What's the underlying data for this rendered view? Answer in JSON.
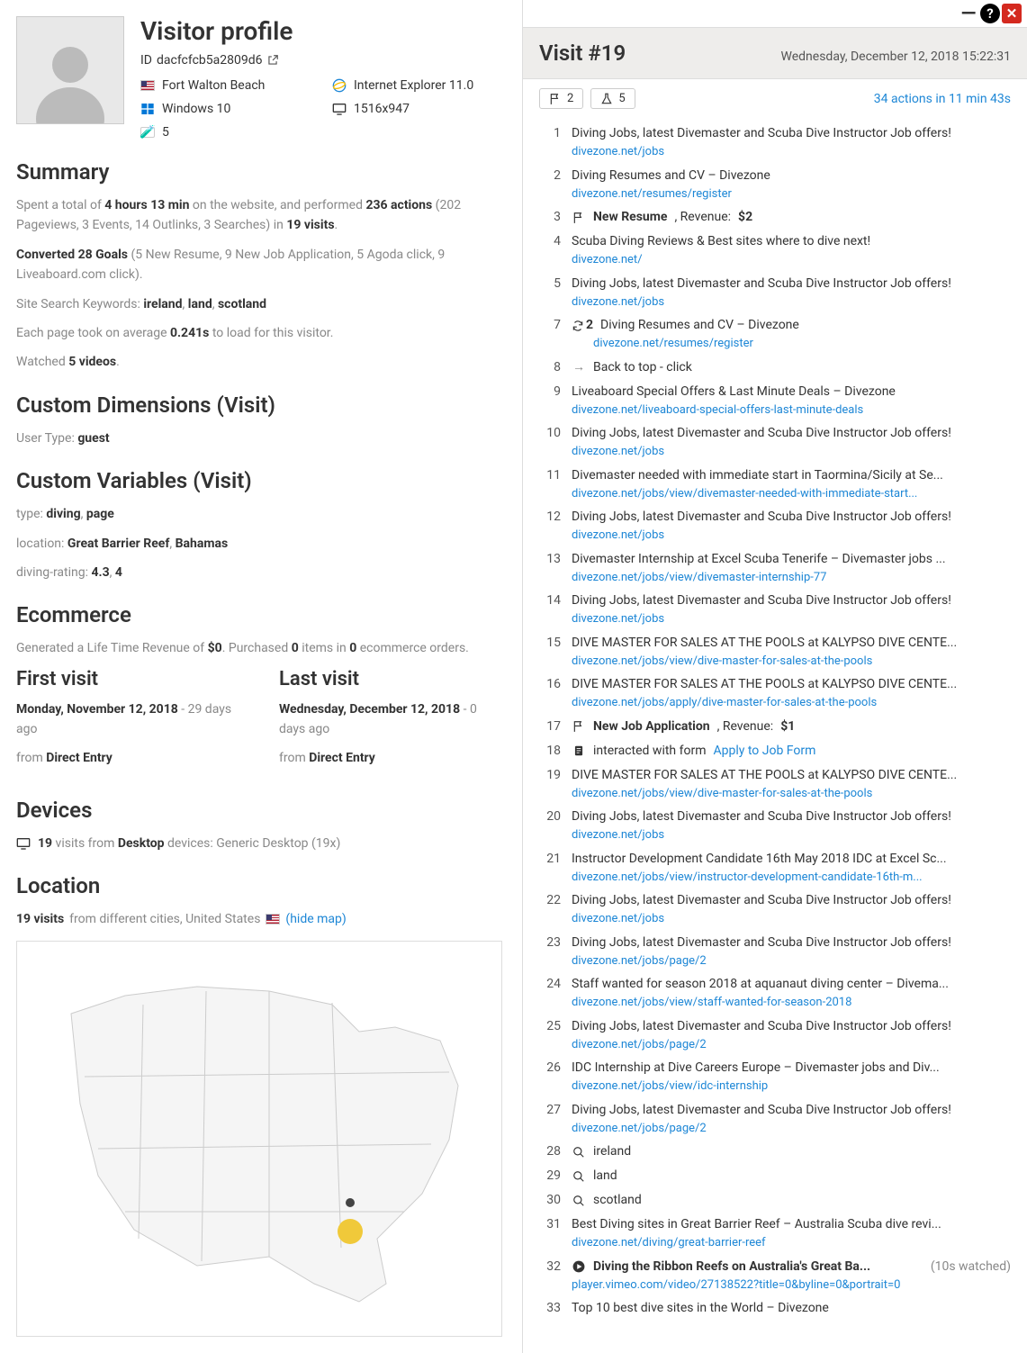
{
  "profile": {
    "title": "Visitor profile",
    "id_label": "ID",
    "id": "dacfcfcb5a2809d6",
    "location": "Fort Walton Beach",
    "browser": "Internet Explorer 11.0",
    "os": "Windows 10",
    "resolution": "1516x947",
    "goals_count": "5"
  },
  "summary": {
    "heading": "Summary",
    "l1a": "Spent a total of ",
    "l1b": "4 hours 13 min",
    "l1c": " on the website, and performed ",
    "l1d": "236 actions",
    "l1e": " (202 Pageviews, 3 Events, 14 Outlinks, 3 Searches) in ",
    "l1f": "19 visits",
    "l1g": ".",
    "l2a": "Converted 28 Goals ",
    "l2b": "(5 New Resume, 9 New Job Application, 5 Agoda click, 9 Liveaboard.com click).",
    "l3a": "Site Search Keywords: ",
    "k1": "ireland",
    "k2": "land",
    "k3": "scotland",
    "l4a": "Each page took on average ",
    "l4b": "0.241s",
    "l4c": " to load for this visitor.",
    "l5a": "Watched ",
    "l5b": "5 videos",
    "l5c": "."
  },
  "customDim": {
    "heading": "Custom Dimensions (Visit)",
    "line": "User Type: ",
    "value": "guest"
  },
  "customVar": {
    "heading": "Custom Variables (Visit)",
    "l1": "type: ",
    "v1a": "diving",
    "v1b": "page",
    "l2": "location: ",
    "v2a": "Great Barrier Reef",
    "v2b": "Bahamas",
    "l3": "diving-rating: ",
    "v3a": "4.3",
    "v3b": "4"
  },
  "ecommerce": {
    "heading": "Ecommerce",
    "a": "Generated a Life Time Revenue of ",
    "b": "$0",
    "c": ". Purchased ",
    "d": "0",
    "e": " items in ",
    "f": "0",
    "g": " ecommerce orders."
  },
  "firstVisit": {
    "heading": "First visit",
    "date": "Monday, November 12, 2018",
    "ago": " - 29 days ago",
    "from": "from ",
    "source": "Direct Entry"
  },
  "lastVisit": {
    "heading": "Last visit",
    "date": "Wednesday, December 12, 2018",
    "ago": " - 0 days ago",
    "from": "from ",
    "source": "Direct Entry"
  },
  "devices": {
    "heading": "Devices",
    "a": "19",
    "b": " visits from ",
    "c": "Desktop",
    "d": " devices: Generic Desktop (19x)"
  },
  "locationSec": {
    "heading": "Location",
    "a": "19 visits",
    "b": " from different cities, United States ",
    "hide": "(hide map)"
  },
  "visit": {
    "title": "Visit #19",
    "date": "Wednesday, December 12, 2018 15:22:31",
    "badge1": "2",
    "badge2": "5",
    "summary": "34 actions in 11 min 43s"
  },
  "actions": [
    {
      "n": "1",
      "t": "page",
      "title": "Diving Jobs, latest Divemaster and Scuba Dive Instructor Job offers!",
      "url": "divezone.net/jobs"
    },
    {
      "n": "2",
      "t": "page",
      "title": "Diving Resumes and CV – Divezone",
      "url": "divezone.net/resumes/register"
    },
    {
      "n": "3",
      "t": "goal",
      "title": "New Resume",
      "rev": "$2"
    },
    {
      "n": "4",
      "t": "page",
      "title": "Scuba Diving Reviews & Best sites where to dive next!",
      "url": "divezone.net/"
    },
    {
      "n": "5",
      "t": "page",
      "title": "Diving Jobs, latest Divemaster and Scuba Dive Instructor Job offers!",
      "url": "divezone.net/jobs"
    },
    {
      "n": "7",
      "t": "refresh",
      "count": "2",
      "title": "Diving Resumes and CV – Divezone",
      "url": "divezone.net/resumes/register"
    },
    {
      "n": "8",
      "t": "event",
      "title": "Back to top - click"
    },
    {
      "n": "9",
      "t": "page",
      "title": "Liveaboard Special Offers & Last Minute Deals – Divezone",
      "url": "divezone.net/liveaboard-special-offers-last-minute-deals"
    },
    {
      "n": "10",
      "t": "page",
      "title": "Diving Jobs, latest Divemaster and Scuba Dive Instructor Job offers!",
      "url": "divezone.net/jobs"
    },
    {
      "n": "11",
      "t": "page",
      "title": "Divemaster needed with immediate start in Taormina/Sicily at Se...",
      "url": "divezone.net/jobs/view/divemaster-needed-with-immediate-start..."
    },
    {
      "n": "12",
      "t": "page",
      "title": "Diving Jobs, latest Divemaster and Scuba Dive Instructor Job offers!",
      "url": "divezone.net/jobs"
    },
    {
      "n": "13",
      "t": "page",
      "title": "Divemaster Internship at Excel Scuba Tenerife – Divemaster jobs ...",
      "url": "divezone.net/jobs/view/divemaster-internship-77"
    },
    {
      "n": "14",
      "t": "page",
      "title": "Diving Jobs, latest Divemaster and Scuba Dive Instructor Job offers!",
      "url": "divezone.net/jobs"
    },
    {
      "n": "15",
      "t": "page",
      "title": "DIVE MASTER FOR SALES AT THE POOLS at KALYPSO DIVE CENTE...",
      "url": "divezone.net/jobs/view/dive-master-for-sales-at-the-pools"
    },
    {
      "n": "16",
      "t": "page",
      "title": "DIVE MASTER FOR SALES AT THE POOLS at KALYPSO DIVE CENTE...",
      "url": "divezone.net/jobs/apply/dive-master-for-sales-at-the-pools"
    },
    {
      "n": "17",
      "t": "goal",
      "title": "New Job Application",
      "rev": "$1"
    },
    {
      "n": "18",
      "t": "form",
      "title": "interacted with form ",
      "link": "Apply to Job Form"
    },
    {
      "n": "19",
      "t": "page",
      "title": "DIVE MASTER FOR SALES AT THE POOLS at KALYPSO DIVE CENTE...",
      "url": "divezone.net/jobs/view/dive-master-for-sales-at-the-pools"
    },
    {
      "n": "20",
      "t": "page",
      "title": "Diving Jobs, latest Divemaster and Scuba Dive Instructor Job offers!",
      "url": "divezone.net/jobs"
    },
    {
      "n": "21",
      "t": "page",
      "title": "Instructor Development Candidate 16th May 2018 IDC at Excel Sc...",
      "url": "divezone.net/jobs/view/instructor-development-candidate-16th-m..."
    },
    {
      "n": "22",
      "t": "page",
      "title": "Diving Jobs, latest Divemaster and Scuba Dive Instructor Job offers!",
      "url": "divezone.net/jobs"
    },
    {
      "n": "23",
      "t": "page",
      "title": "Diving Jobs, latest Divemaster and Scuba Dive Instructor Job offers!",
      "url": "divezone.net/jobs/page/2"
    },
    {
      "n": "24",
      "t": "page",
      "title": "Staff wanted for season 2018 at aquanaut diving center – Divema...",
      "url": "divezone.net/jobs/view/staff-wanted-for-season-2018"
    },
    {
      "n": "25",
      "t": "page",
      "title": "Diving Jobs, latest Divemaster and Scuba Dive Instructor Job offers!",
      "url": "divezone.net/jobs/page/2"
    },
    {
      "n": "26",
      "t": "page",
      "title": "IDC Internship at Dive Careers Europe – Divemaster jobs and Div...",
      "url": "divezone.net/jobs/view/idc-internship"
    },
    {
      "n": "27",
      "t": "page",
      "title": "Diving Jobs, latest Divemaster and Scuba Dive Instructor Job offers!",
      "url": "divezone.net/jobs/page/2"
    },
    {
      "n": "28",
      "t": "search",
      "title": "ireland"
    },
    {
      "n": "29",
      "t": "search",
      "title": "land"
    },
    {
      "n": "30",
      "t": "search",
      "title": "scotland"
    },
    {
      "n": "31",
      "t": "page",
      "title": "Best Diving sites in Great Barrier Reef – Australia Scuba dive revi...",
      "url": "divezone.net/diving/great-barrier-reef"
    },
    {
      "n": "32",
      "t": "media",
      "title": "Diving the Ribbon Reefs on Australia's Great Ba...",
      "meta": "(10s watched)",
      "url": "player.vimeo.com/video/27138522?title=0&byline=0&portrait=0"
    },
    {
      "n": "33",
      "t": "page",
      "title": "Top 10 best dive sites in the World – Divezone",
      "url": ""
    }
  ]
}
